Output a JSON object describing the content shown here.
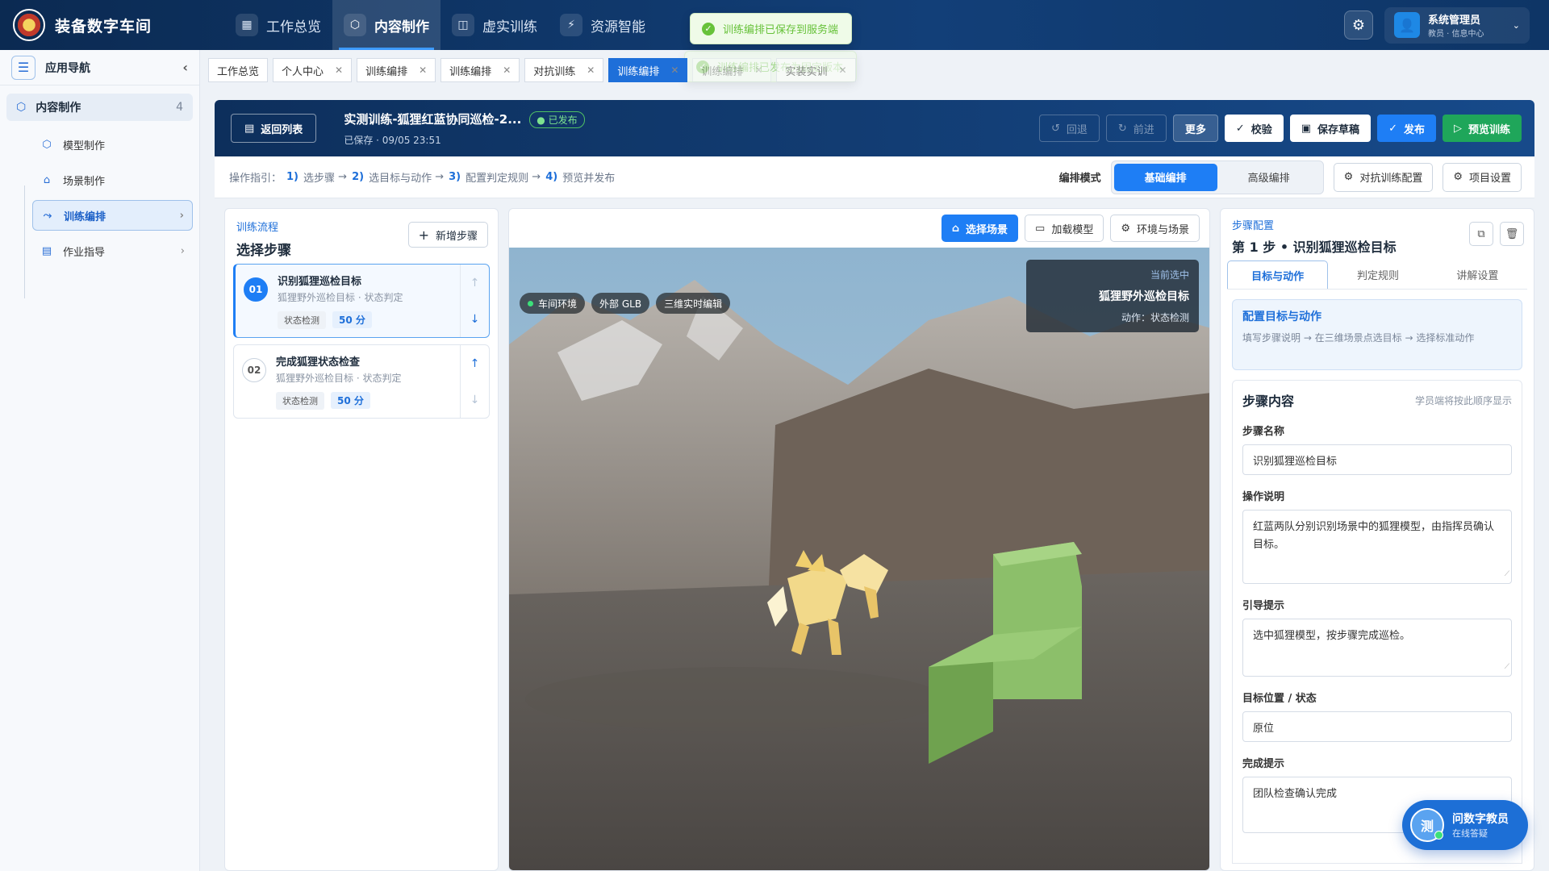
{
  "app": {
    "brand": "装备数字车间"
  },
  "topnav": {
    "items": [
      {
        "label": "工作总览",
        "icon": "grid-icon"
      },
      {
        "label": "内容制作",
        "icon": "cube-icon",
        "active": true
      },
      {
        "label": "虚实训练",
        "icon": "book-icon"
      },
      {
        "label": "资源智能",
        "icon": "ai-icon"
      }
    ],
    "user": {
      "name": "系统管理员",
      "role": "教员 · 信息中心"
    }
  },
  "toasts": [
    "训练编排已保存到服务端",
    "训练编排已发布为固定版本"
  ],
  "sidebar": {
    "title": "应用导航",
    "group": {
      "label": "内容制作",
      "count": "4"
    },
    "items": [
      {
        "label": "模型制作",
        "icon": "cube-icon"
      },
      {
        "label": "场景制作",
        "icon": "home-icon"
      },
      {
        "label": "训练编排",
        "icon": "flow-icon",
        "active": true
      },
      {
        "label": "作业指导",
        "icon": "doc-icon"
      }
    ]
  },
  "tabs": [
    "工作总览",
    "个人中心",
    "训练编排",
    "训练编排",
    "对抗训练",
    "训练编排",
    "训练编排",
    "实装实训"
  ],
  "header": {
    "back": "返回列表",
    "title": "实测训练-狐狸红蓝协同巡检-2...",
    "status": "已发布",
    "saved": "已保存 · 09/05 23:51",
    "buttons": {
      "undo": "回退",
      "redo": "前进",
      "more": "更多",
      "check": "校验",
      "draft": "保存草稿",
      "publish": "发布",
      "preview": "预览训练"
    }
  },
  "guide": {
    "prefix": "操作指引：",
    "steps": [
      {
        "n": "1)",
        "t": "选步骤"
      },
      {
        "n": "2)",
        "t": "选目标与动作"
      },
      {
        "n": "3)",
        "t": "配置判定规则"
      },
      {
        "n": "4)",
        "t": "预览并发布"
      }
    ],
    "arrow": "→",
    "mode_label": "编排模式",
    "mode_basic": "基础编排",
    "mode_adv": "高级编排",
    "btn_vs": "对抗训练配置",
    "btn_proj": "项目设置"
  },
  "flow": {
    "kicker": "训练流程",
    "title": "选择步骤",
    "add": "新增步骤",
    "steps": [
      {
        "num": "01",
        "name": "识别狐狸巡检目标",
        "desc": "狐狸野外巡检目标 · 状态判定",
        "tag": "状态检测",
        "score": "50 分"
      },
      {
        "num": "02",
        "name": "完成狐狸状态检查",
        "desc": "狐狸野外巡检目标 · 状态判定",
        "tag": "状态检测",
        "score": "50 分"
      }
    ]
  },
  "viewport": {
    "btn_scene": "选择场景",
    "btn_model": "加载模型",
    "btn_env": "环境与场景",
    "chips": [
      "车间环境",
      "外部 GLB",
      "三维实时编辑"
    ],
    "selected": {
      "kicker": "当前选中",
      "name": "狐狸野外巡检目标",
      "action": "动作：状态检测"
    }
  },
  "config": {
    "kicker": "步骤配置",
    "title": "第 1 步 • 识别狐狸巡检目标",
    "tabs": [
      "目标与动作",
      "判定规则",
      "讲解设置"
    ],
    "info_title": "配置目标与动作",
    "info_body": "填写步骤说明 → 在三维场景点选目标 → 选择标准动作",
    "section": "步骤内容",
    "section_hint": "学员端将按此顺序显示",
    "fields": {
      "name_label": "步骤名称",
      "name": "识别狐狸巡检目标",
      "op_label": "操作说明",
      "op": "红蓝两队分别识别场景中的狐狸模型，由指挥员确认目标。",
      "hint_label": "引导提示",
      "hint": "选中狐狸模型，按步骤完成巡检。",
      "pos_label": "目标位置 / 状态",
      "pos": "原位",
      "done_label": "完成提示",
      "done": "团队检查确认完成"
    }
  },
  "assistant": {
    "avatar": "测",
    "name": "问数字教员",
    "status": "在线答疑"
  }
}
